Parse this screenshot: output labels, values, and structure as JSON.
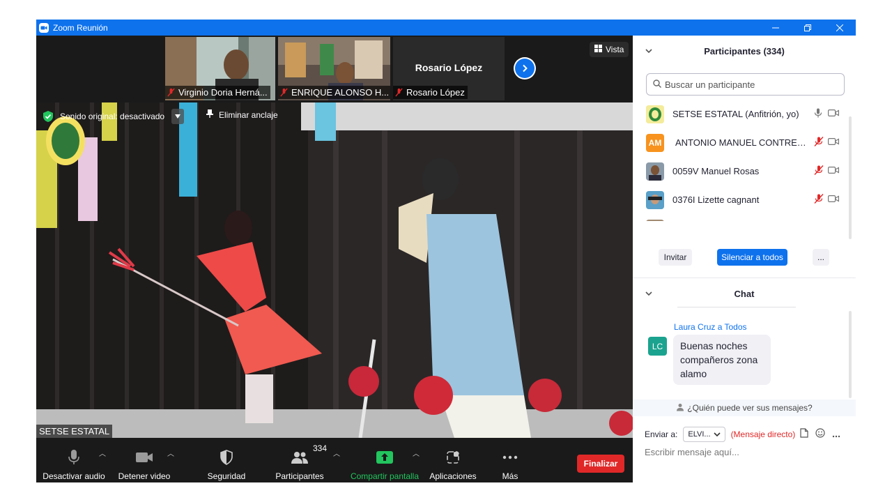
{
  "window": {
    "title": "Zoom Reunión",
    "controls": [
      "minimize-icon",
      "restore-icon",
      "close-icon"
    ]
  },
  "gallery": {
    "thumbnails": [
      {
        "name": "Virginio Doria Herná..."
      },
      {
        "name": "ENRIQUE ALONSO H..."
      },
      {
        "name": "Rosario López",
        "display_name": "Rosario López"
      }
    ],
    "view_button": "Vista"
  },
  "stage": {
    "sound_label": "Sonido original: desactivado",
    "pin_label": "Eliminar anclaje",
    "speaker_label": "SETSE ESTATAL"
  },
  "toolbar": {
    "audio": "Desactivar audio",
    "video": "Detener video",
    "security": "Seguridad",
    "participants": "Participantes",
    "participants_count": "334",
    "share": "Compartir pantalla",
    "apps": "Aplicaciones",
    "more": "Más",
    "end": "Finalizar"
  },
  "participants_panel": {
    "title": "Participantes (334)",
    "search_placeholder": "Buscar un participante",
    "list": [
      {
        "name": "SETSE ESTATAL (Anfitrión, yo)",
        "mic": "on"
      },
      {
        "name": "ANTONIO MANUEL CONTRER...",
        "initials": "AM",
        "mic": "muted"
      },
      {
        "name": "0059V Manuel Rosas",
        "mic": "muted"
      },
      {
        "name": "0376I Lizette cagnant",
        "mic": "muted"
      }
    ],
    "invite": "Invitar",
    "mute_all": "Silenciar a todos",
    "more": "..."
  },
  "chat_panel": {
    "title": "Chat",
    "messages": [
      {
        "sender": "Laura Cruz a Todos",
        "initials": "LC",
        "text": "Buenas noches compañeros zona alamo"
      }
    ],
    "who_sees": "¿Quién puede ver sus mensajes?",
    "send_to_label": "Enviar a:",
    "send_to_value": "ELVI...",
    "direct_label": "(Mensaje directo)",
    "input_placeholder": "Escribir mensaje aquí..."
  },
  "colors": {
    "accent": "#0e72ed",
    "danger": "#e02828",
    "share_green": "#22c55e",
    "chat_avatar": "#1ba38f"
  }
}
